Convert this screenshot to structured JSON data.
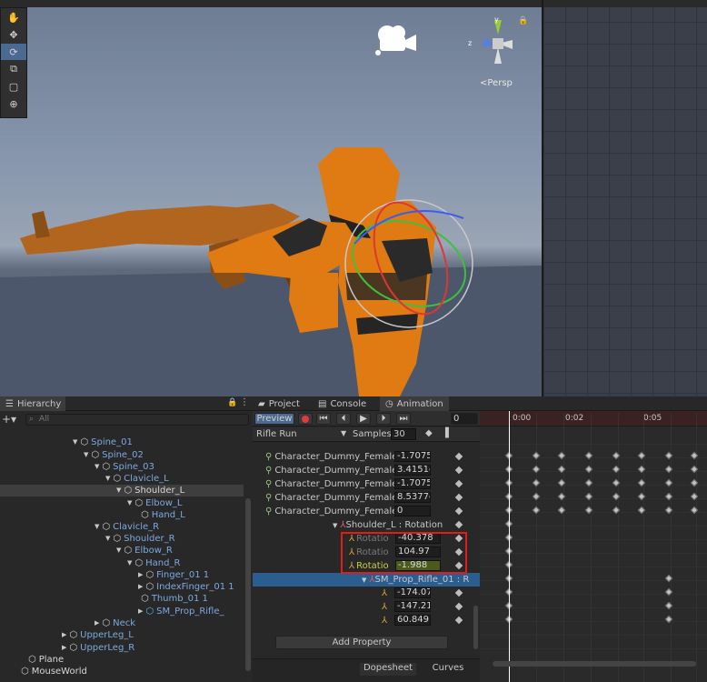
{
  "scene": {
    "persp_label": "<Persp",
    "gizmo": {
      "x": "x",
      "y": "y",
      "z": "z"
    },
    "tools": [
      "hand-icon",
      "move-icon",
      "rotate-icon",
      "scale-icon",
      "rect-icon",
      "transform-icon"
    ]
  },
  "hierarchy": {
    "tab_label": "Hierarchy",
    "search_placeholder": "All",
    "items": [
      {
        "label": "Spine_01",
        "color": "blue"
      },
      {
        "label": "Spine_02",
        "color": "blue"
      },
      {
        "label": "Spine_03",
        "color": "blue"
      },
      {
        "label": "Clavicle_L",
        "color": "blue"
      },
      {
        "label": "Shoulder_L",
        "color": "white"
      },
      {
        "label": "Elbow_L",
        "color": "blue"
      },
      {
        "label": "Hand_L",
        "color": "blue"
      },
      {
        "label": "Clavicle_R",
        "color": "blue"
      },
      {
        "label": "Shoulder_R",
        "color": "blue"
      },
      {
        "label": "Elbow_R",
        "color": "blue"
      },
      {
        "label": "Hand_R",
        "color": "blue"
      },
      {
        "label": "Finger_01 1",
        "color": "blue"
      },
      {
        "label": "IndexFinger_01 1",
        "color": "blue"
      },
      {
        "label": "Thumb_01 1",
        "color": "blue"
      },
      {
        "label": "SM_Prop_Rifle_",
        "color": "blue"
      },
      {
        "label": "Neck",
        "color": "blue"
      },
      {
        "label": "UpperLeg_L",
        "color": "blue"
      },
      {
        "label": "UpperLeg_R",
        "color": "blue"
      },
      {
        "label": "Plane",
        "color": "white"
      },
      {
        "label": "MouseWorld",
        "color": "white"
      }
    ]
  },
  "animation": {
    "tabs": [
      "Project",
      "Console",
      "Animation"
    ],
    "preview_label": "Preview",
    "frame_value": "0",
    "clip_name": "Rifle Run",
    "samples_label": "Samples",
    "samples_value": "30",
    "properties": [
      {
        "label": "Character_Dummy_Female_",
        "value": "-1.7075"
      },
      {
        "label": "Character_Dummy_Female_",
        "value": "3.4151e"
      },
      {
        "label": "Character_Dummy_Female_",
        "value": "-1.7075"
      },
      {
        "label": "Character_Dummy_Female_",
        "value": "8.5377e"
      },
      {
        "label": "Character_Dummy_Female_",
        "value": "0"
      }
    ],
    "shoulder_group": "Shoulder_L : Rotation",
    "rotations": [
      {
        "label": "Rotatio",
        "value": "-40.378"
      },
      {
        "label": "Rotatio",
        "value": "104.97"
      },
      {
        "label": "Rotatio",
        "value": "-1.988"
      }
    ],
    "rifle_group": "SM_Prop_Rifle_01 : R",
    "rifle_values": [
      "-174.07",
      "-147.21",
      "60.849"
    ],
    "add_property": "Add Property",
    "bottom_tabs": [
      "Dopesheet",
      "Curves"
    ]
  },
  "timeline": {
    "ticks": [
      "0:00",
      "0:02",
      "0:05"
    ]
  },
  "colors": {
    "accent": "#4a6a92",
    "highlight_box": "#e01c1c",
    "selected_row": "#2c5d8f",
    "hierarchy_blue": "#7ea8e0",
    "character_orange": "#e07a12"
  }
}
